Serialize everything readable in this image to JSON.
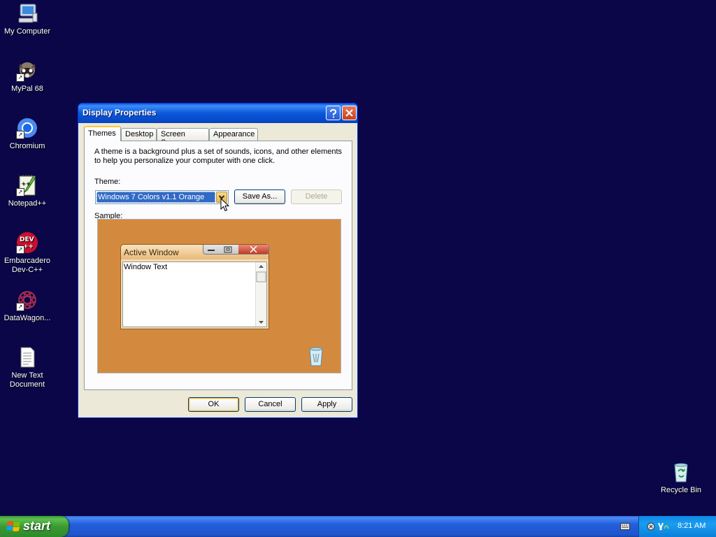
{
  "desktop": {
    "icons": [
      {
        "label": "My Computer"
      },
      {
        "label": "MyPal 68"
      },
      {
        "label": "Chromium"
      },
      {
        "label": "Notepad++"
      },
      {
        "label": "Embarcadero Dev-C++"
      },
      {
        "label": "DataWagon..."
      },
      {
        "label": "New Text Document"
      },
      {
        "label": "Recycle Bin"
      }
    ]
  },
  "dialog": {
    "title": "Display Properties",
    "tabs": [
      "Themes",
      "Desktop",
      "Screen Saver",
      "Appearance"
    ],
    "description": "A theme is a background plus a set of sounds, icons, and other elements to help you personalize your computer with one click.",
    "theme_label": "Theme:",
    "theme_value": "Windows 7 Colors v1.1 Orange",
    "save_as_label": "Save As...",
    "delete_label": "Delete",
    "sample_label": "Sample:",
    "sample": {
      "window_title": "Active Window",
      "window_text": "Window Text"
    },
    "ok_label": "OK",
    "cancel_label": "Cancel",
    "apply_label": "Apply"
  },
  "taskbar": {
    "start_label": "start",
    "clock": "8:21 AM"
  },
  "colors": {
    "desktop_bg": "#0a0647",
    "sample_bg": "#d48a3e",
    "titlebar": "#0a58d8",
    "selection": "#316ac5"
  }
}
